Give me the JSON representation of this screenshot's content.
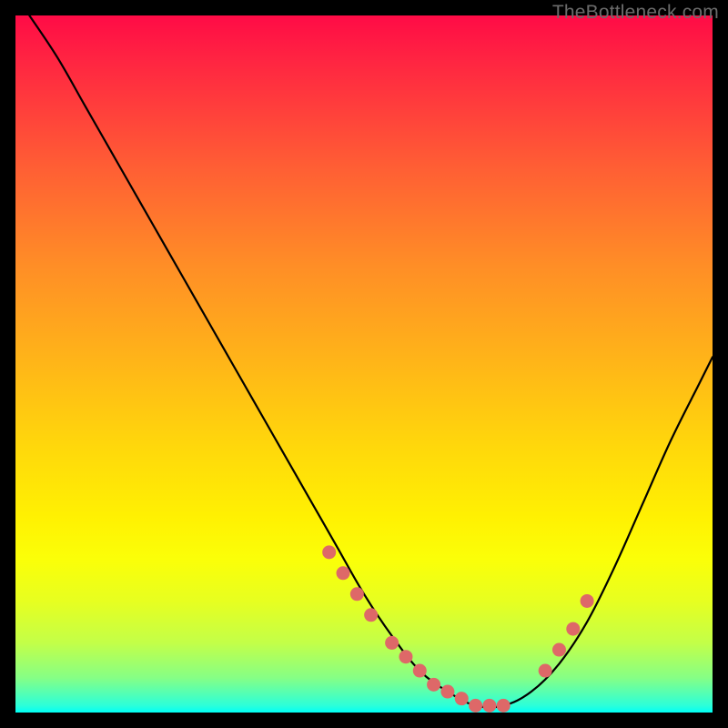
{
  "watermark": "TheBottleneck.com",
  "chart_data": {
    "type": "line",
    "title": "",
    "xlabel": "",
    "ylabel": "",
    "xlim": [
      0,
      100
    ],
    "ylim": [
      0,
      100
    ],
    "grid": false,
    "legend": false,
    "series": [
      {
        "name": "bottleneck-curve",
        "color": "#000000",
        "x": [
          2,
          6,
          10,
          14,
          18,
          22,
          26,
          30,
          34,
          38,
          42,
          46,
          50,
          54,
          58,
          62,
          66,
          70,
          74,
          78,
          82,
          86,
          90,
          94,
          98,
          100
        ],
        "y": [
          100,
          94,
          87,
          80,
          73,
          66,
          59,
          52,
          45,
          38,
          31,
          24,
          17,
          11,
          6,
          3,
          1,
          1,
          3,
          7,
          13,
          21,
          30,
          39,
          47,
          51
        ]
      },
      {
        "name": "highlight-dots-left",
        "color": "#de6868",
        "style": "marker",
        "x": [
          45,
          47,
          49,
          51,
          54,
          56,
          58,
          60,
          62,
          64,
          66,
          68,
          70
        ],
        "y": [
          23,
          20,
          17,
          14,
          10,
          8,
          6,
          4,
          3,
          2,
          1,
          1,
          1
        ]
      },
      {
        "name": "highlight-dots-right",
        "color": "#de6868",
        "style": "marker",
        "x": [
          76,
          78,
          80,
          82
        ],
        "y": [
          6,
          9,
          12,
          16
        ]
      }
    ]
  }
}
